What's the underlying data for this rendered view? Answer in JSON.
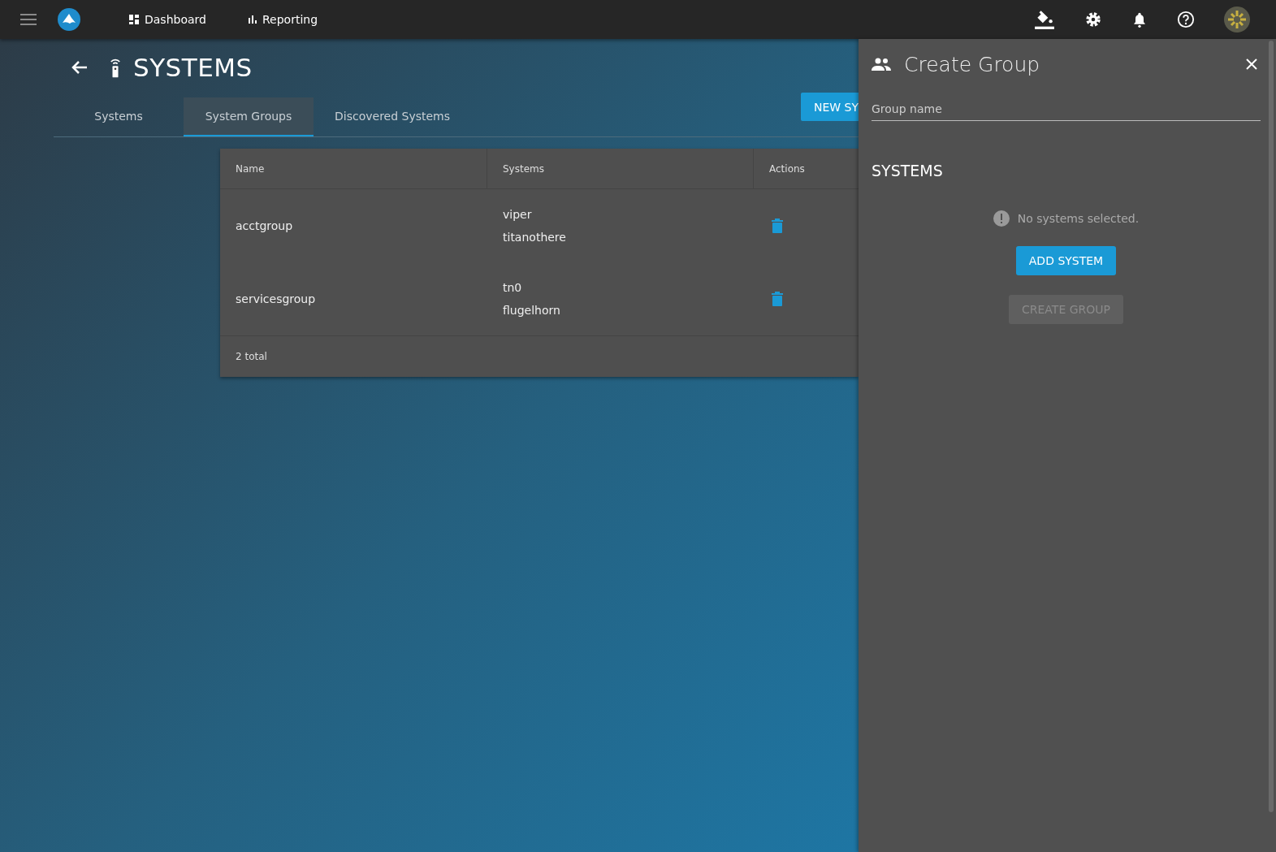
{
  "topbar": {
    "nav": [
      {
        "label": "Dashboard",
        "kind": "dashboard"
      },
      {
        "label": "Reporting",
        "kind": "report"
      }
    ]
  },
  "page": {
    "title": "SYSTEMS",
    "new_button": "NEW SY"
  },
  "tabs": [
    {
      "label": "Systems",
      "selected": false
    },
    {
      "label": "System Groups",
      "selected": true
    },
    {
      "label": "Discovered Systems",
      "selected": false
    }
  ],
  "table": {
    "columns": [
      "Name",
      "Systems",
      "Actions"
    ],
    "rows": [
      {
        "name": "acctgroup",
        "systems": [
          "viper",
          "titanothere"
        ]
      },
      {
        "name": "servicesgroup",
        "systems": [
          "tn0",
          "flugelhorn"
        ]
      }
    ],
    "footer": "2 total"
  },
  "drawer": {
    "title": "Create Group",
    "field": {
      "placeholder": "Group name"
    },
    "section": "SYSTEMS",
    "empty_message": "No systems selected.",
    "add_button": "ADD SYSTEM",
    "create_button": {
      "label": "CREATE GROUP",
      "disabled": true
    }
  }
}
